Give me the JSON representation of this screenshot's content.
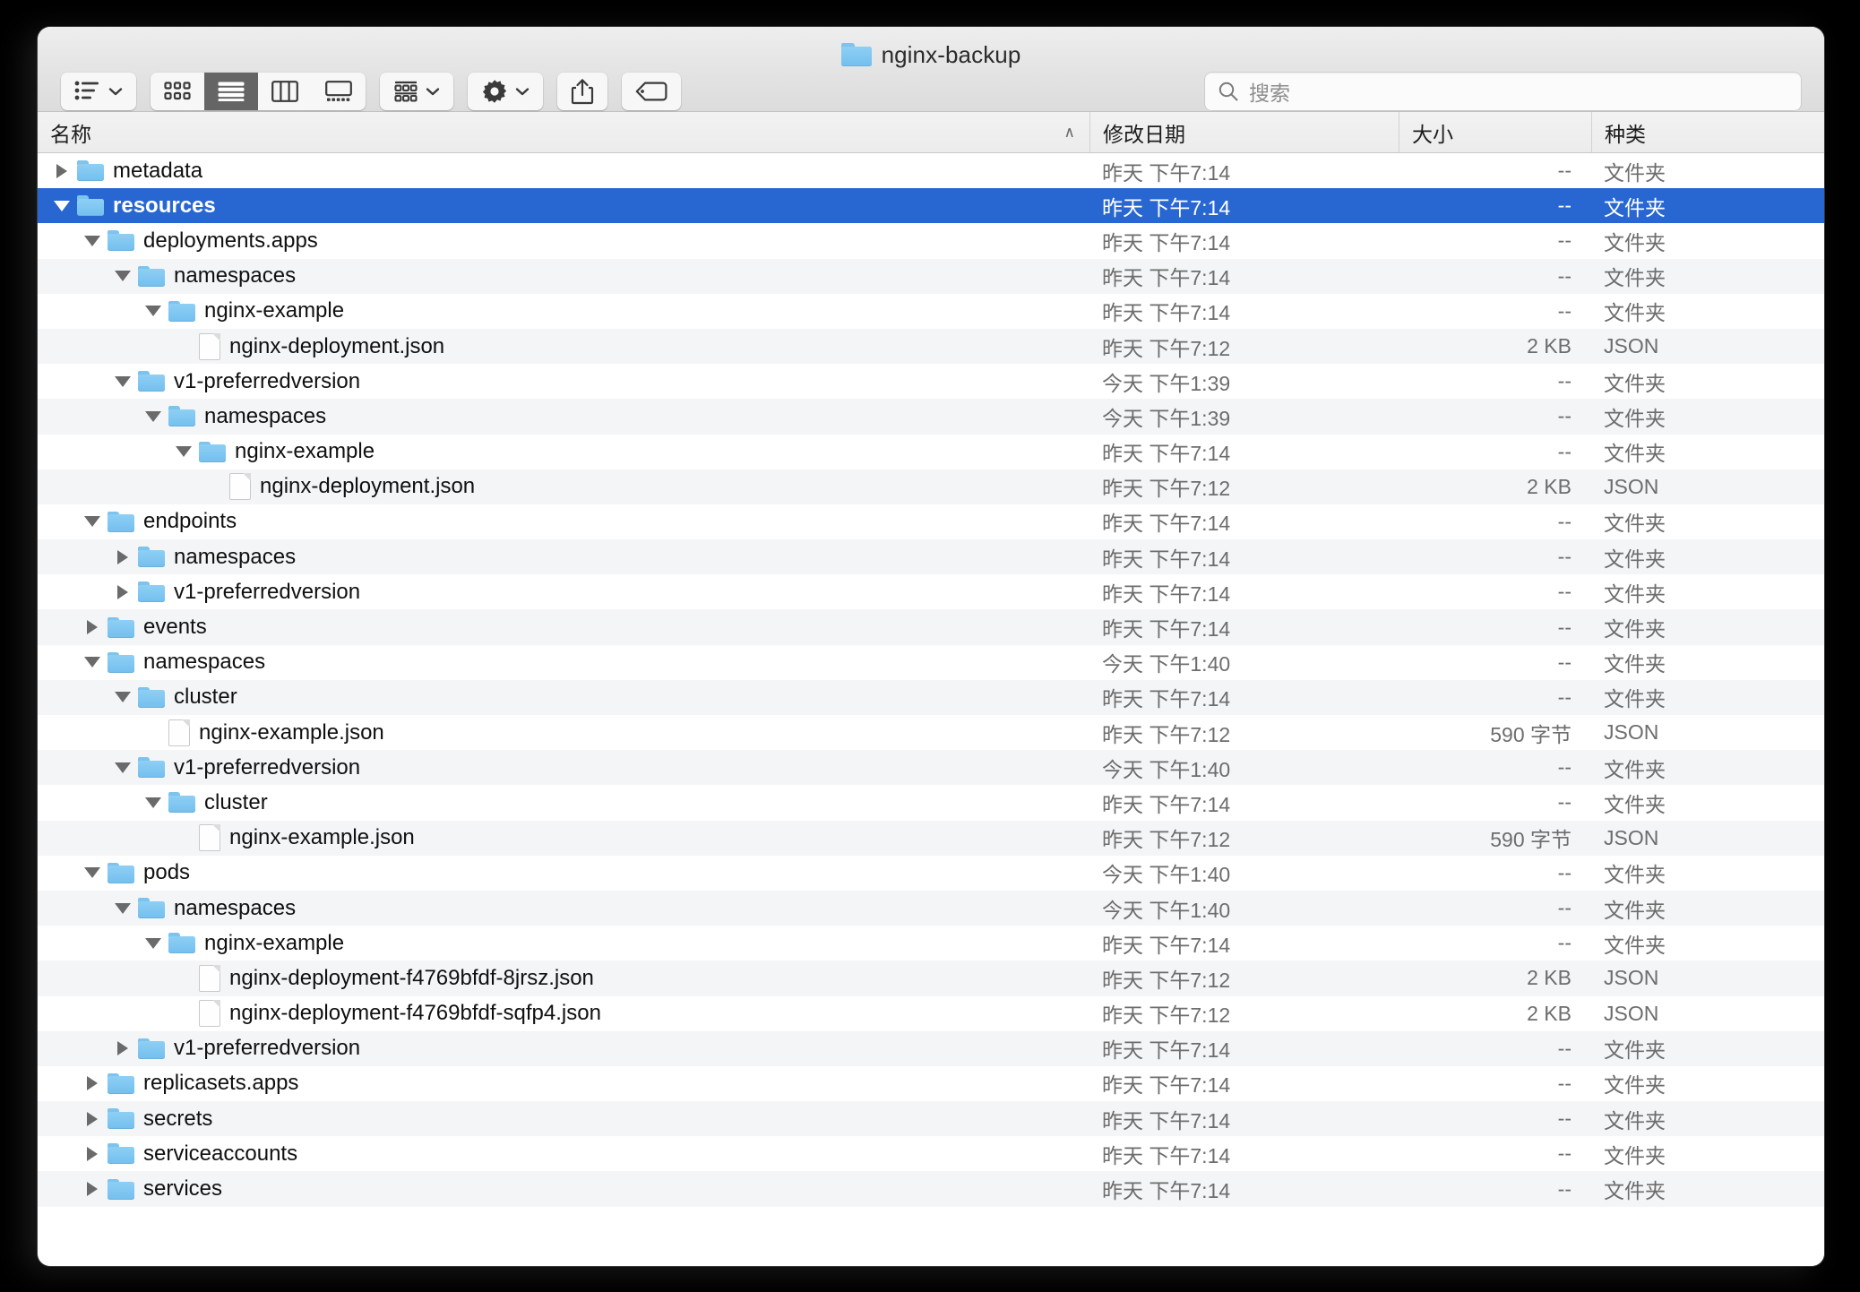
{
  "window": {
    "title": "nginx-backup",
    "title_icon": "folder-icon"
  },
  "toolbar": {
    "buttons": [
      {
        "name": "view-options-button",
        "icon": "list-bullets-icon",
        "label": ""
      },
      {
        "name": "icon-view-button",
        "icon": "grid-view-icon",
        "label": ""
      },
      {
        "name": "list-view-button",
        "icon": "list-view-icon",
        "label": ""
      },
      {
        "name": "column-view-button",
        "icon": "column-view-icon",
        "label": ""
      },
      {
        "name": "gallery-view-button",
        "icon": "gallery-view-icon",
        "label": ""
      },
      {
        "name": "group-by-button",
        "icon": "group-by-icon",
        "label": ""
      },
      {
        "name": "action-menu-button",
        "icon": "gear-icon",
        "label": ""
      },
      {
        "name": "share-button",
        "icon": "share-icon",
        "label": ""
      },
      {
        "name": "tags-button",
        "icon": "tag-icon",
        "label": ""
      }
    ],
    "selected_view": "list-view-button"
  },
  "search": {
    "placeholder": "搜索",
    "value": "",
    "icon": "search-icon"
  },
  "columns": {
    "name": "名称",
    "date": "修改日期",
    "size": "大小",
    "kind": "种类",
    "sort_arrow": "∧",
    "sorted_by": "name"
  },
  "colors": {
    "selection_blue": "#2867d2",
    "folder_blue": "#7fc6f0",
    "alt_row": "#f4f5f7",
    "toolbar_bg": "#e3e3e3"
  },
  "rows": [
    {
      "name": "metadata",
      "depth": 0,
      "type": "folder",
      "twisty": "closed",
      "date": "昨天 下午7:14",
      "size": "--",
      "kind": "文件夹",
      "selected": false
    },
    {
      "name": "resources",
      "depth": 0,
      "type": "folder",
      "twisty": "open",
      "date": "昨天 下午7:14",
      "size": "--",
      "kind": "文件夹",
      "selected": true
    },
    {
      "name": "deployments.apps",
      "depth": 1,
      "type": "folder",
      "twisty": "open",
      "date": "昨天 下午7:14",
      "size": "--",
      "kind": "文件夹",
      "selected": false
    },
    {
      "name": "namespaces",
      "depth": 2,
      "type": "folder",
      "twisty": "open",
      "date": "昨天 下午7:14",
      "size": "--",
      "kind": "文件夹",
      "selected": false
    },
    {
      "name": "nginx-example",
      "depth": 3,
      "type": "folder",
      "twisty": "open",
      "date": "昨天 下午7:14",
      "size": "--",
      "kind": "文件夹",
      "selected": false
    },
    {
      "name": "nginx-deployment.json",
      "depth": 4,
      "type": "file",
      "twisty": "none",
      "date": "昨天 下午7:12",
      "size": "2 KB",
      "kind": "JSON",
      "selected": false
    },
    {
      "name": "v1-preferredversion",
      "depth": 2,
      "type": "folder",
      "twisty": "open",
      "date": "今天 下午1:39",
      "size": "--",
      "kind": "文件夹",
      "selected": false
    },
    {
      "name": "namespaces",
      "depth": 3,
      "type": "folder",
      "twisty": "open",
      "date": "今天 下午1:39",
      "size": "--",
      "kind": "文件夹",
      "selected": false
    },
    {
      "name": "nginx-example",
      "depth": 4,
      "type": "folder",
      "twisty": "open",
      "date": "昨天 下午7:14",
      "size": "--",
      "kind": "文件夹",
      "selected": false
    },
    {
      "name": "nginx-deployment.json",
      "depth": 5,
      "type": "file",
      "twisty": "none",
      "date": "昨天 下午7:12",
      "size": "2 KB",
      "kind": "JSON",
      "selected": false
    },
    {
      "name": "endpoints",
      "depth": 1,
      "type": "folder",
      "twisty": "open",
      "date": "昨天 下午7:14",
      "size": "--",
      "kind": "文件夹",
      "selected": false
    },
    {
      "name": "namespaces",
      "depth": 2,
      "type": "folder",
      "twisty": "closed",
      "date": "昨天 下午7:14",
      "size": "--",
      "kind": "文件夹",
      "selected": false
    },
    {
      "name": "v1-preferredversion",
      "depth": 2,
      "type": "folder",
      "twisty": "closed",
      "date": "昨天 下午7:14",
      "size": "--",
      "kind": "文件夹",
      "selected": false
    },
    {
      "name": "events",
      "depth": 1,
      "type": "folder",
      "twisty": "closed",
      "date": "昨天 下午7:14",
      "size": "--",
      "kind": "文件夹",
      "selected": false
    },
    {
      "name": "namespaces",
      "depth": 1,
      "type": "folder",
      "twisty": "open",
      "date": "今天 下午1:40",
      "size": "--",
      "kind": "文件夹",
      "selected": false
    },
    {
      "name": "cluster",
      "depth": 2,
      "type": "folder",
      "twisty": "open",
      "date": "昨天 下午7:14",
      "size": "--",
      "kind": "文件夹",
      "selected": false
    },
    {
      "name": "nginx-example.json",
      "depth": 3,
      "type": "file",
      "twisty": "none",
      "date": "昨天 下午7:12",
      "size": "590 字节",
      "kind": "JSON",
      "selected": false
    },
    {
      "name": "v1-preferredversion",
      "depth": 2,
      "type": "folder",
      "twisty": "open",
      "date": "今天 下午1:40",
      "size": "--",
      "kind": "文件夹",
      "selected": false
    },
    {
      "name": "cluster",
      "depth": 3,
      "type": "folder",
      "twisty": "open",
      "date": "昨天 下午7:14",
      "size": "--",
      "kind": "文件夹",
      "selected": false
    },
    {
      "name": "nginx-example.json",
      "depth": 4,
      "type": "file",
      "twisty": "none",
      "date": "昨天 下午7:12",
      "size": "590 字节",
      "kind": "JSON",
      "selected": false
    },
    {
      "name": "pods",
      "depth": 1,
      "type": "folder",
      "twisty": "open",
      "date": "今天 下午1:40",
      "size": "--",
      "kind": "文件夹",
      "selected": false
    },
    {
      "name": "namespaces",
      "depth": 2,
      "type": "folder",
      "twisty": "open",
      "date": "今天 下午1:40",
      "size": "--",
      "kind": "文件夹",
      "selected": false
    },
    {
      "name": "nginx-example",
      "depth": 3,
      "type": "folder",
      "twisty": "open",
      "date": "昨天 下午7:14",
      "size": "--",
      "kind": "文件夹",
      "selected": false
    },
    {
      "name": "nginx-deployment-f4769bfdf-8jrsz.json",
      "depth": 4,
      "type": "file",
      "twisty": "none",
      "date": "昨天 下午7:12",
      "size": "2 KB",
      "kind": "JSON",
      "selected": false
    },
    {
      "name": "nginx-deployment-f4769bfdf-sqfp4.json",
      "depth": 4,
      "type": "file",
      "twisty": "none",
      "date": "昨天 下午7:12",
      "size": "2 KB",
      "kind": "JSON",
      "selected": false
    },
    {
      "name": "v1-preferredversion",
      "depth": 2,
      "type": "folder",
      "twisty": "closed",
      "date": "昨天 下午7:14",
      "size": "--",
      "kind": "文件夹",
      "selected": false
    },
    {
      "name": "replicasets.apps",
      "depth": 1,
      "type": "folder",
      "twisty": "closed",
      "date": "昨天 下午7:14",
      "size": "--",
      "kind": "文件夹",
      "selected": false
    },
    {
      "name": "secrets",
      "depth": 1,
      "type": "folder",
      "twisty": "closed",
      "date": "昨天 下午7:14",
      "size": "--",
      "kind": "文件夹",
      "selected": false
    },
    {
      "name": "serviceaccounts",
      "depth": 1,
      "type": "folder",
      "twisty": "closed",
      "date": "昨天 下午7:14",
      "size": "--",
      "kind": "文件夹",
      "selected": false
    },
    {
      "name": "services",
      "depth": 1,
      "type": "folder",
      "twisty": "closed",
      "date": "昨天 下午7:14",
      "size": "--",
      "kind": "文件夹",
      "selected": false
    }
  ]
}
